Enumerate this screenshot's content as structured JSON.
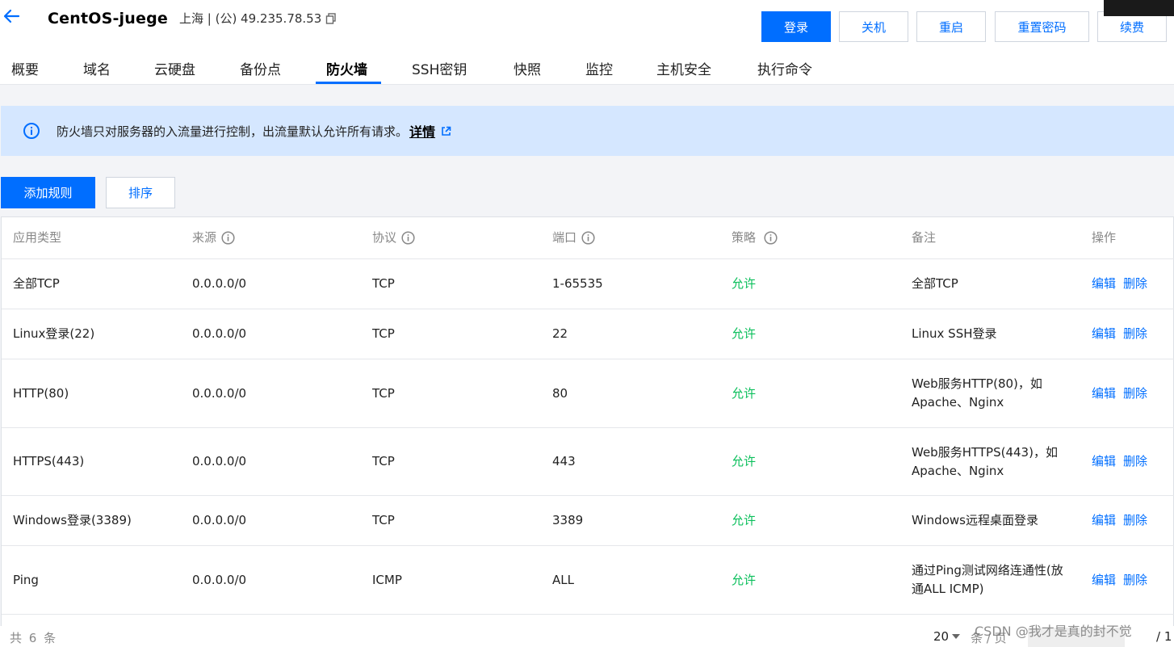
{
  "header": {
    "title": "CentOS-juege",
    "region": "上海 | (公) 49.235.78.53",
    "buttons": {
      "login": "登录",
      "shutdown": "关机",
      "restart": "重启",
      "reset_password": "重置密码",
      "renew": "续费"
    }
  },
  "tabs": [
    "概要",
    "域名",
    "云硬盘",
    "备份点",
    "防火墙",
    "SSH密钥",
    "快照",
    "监控",
    "主机安全",
    "执行命令"
  ],
  "active_tab": "防火墙",
  "notice": {
    "text": "防火墙只对服务器的入流量进行控制，出流量默认允许所有请求。",
    "link": "详情"
  },
  "actions": {
    "add_rule": "添加规则",
    "sort": "排序"
  },
  "table": {
    "columns": {
      "app_type": "应用类型",
      "source": "来源",
      "protocol": "协议",
      "port": "端口",
      "policy": "策略",
      "remark": "备注",
      "ops": "操作"
    },
    "rows": [
      {
        "app_type": "全部TCP",
        "source": "0.0.0.0/0",
        "protocol": "TCP",
        "port": "1-65535",
        "policy": "允许",
        "remark_line1": "全部TCP",
        "remark_line2": "",
        "edit": "编辑",
        "delete": "删除"
      },
      {
        "app_type": "Linux登录(22)",
        "source": "0.0.0.0/0",
        "protocol": "TCP",
        "port": "22",
        "policy": "允许",
        "remark_line1": "Linux SSH登录",
        "remark_line2": "",
        "edit": "编辑",
        "delete": "删除"
      },
      {
        "app_type": "HTTP(80)",
        "source": "0.0.0.0/0",
        "protocol": "TCP",
        "port": "80",
        "policy": "允许",
        "remark_line1": "Web服务HTTP(80)，如",
        "remark_line2": "Apache、Nginx",
        "edit": "编辑",
        "delete": "删除"
      },
      {
        "app_type": "HTTPS(443)",
        "source": "0.0.0.0/0",
        "protocol": "TCP",
        "port": "443",
        "policy": "允许",
        "remark_line1": "Web服务HTTPS(443)，如",
        "remark_line2": "Apache、Nginx",
        "edit": "编辑",
        "delete": "删除"
      },
      {
        "app_type": "Windows登录(3389)",
        "source": "0.0.0.0/0",
        "protocol": "TCP",
        "port": "3389",
        "policy": "允许",
        "remark_line1": "Windows远程桌面登录",
        "remark_line2": "",
        "edit": "编辑",
        "delete": "删除"
      },
      {
        "app_type": "Ping",
        "source": "0.0.0.0/0",
        "protocol": "ICMP",
        "port": "ALL",
        "policy": "允许",
        "remark_line1": "通过Ping测试网络连通性(放",
        "remark_line2": "通ALL ICMP)",
        "edit": "编辑",
        "delete": "删除"
      }
    ]
  },
  "pagination": {
    "total": "共 6 条",
    "page_size": "20",
    "per_page": "条 / 页",
    "page_info": "/ 1"
  },
  "watermark": "CSDN @我才是真的封不觉",
  "colors": {
    "primary": "#006eff",
    "allow": "#0abf5b",
    "notice_bg": "#d5e7ff"
  }
}
